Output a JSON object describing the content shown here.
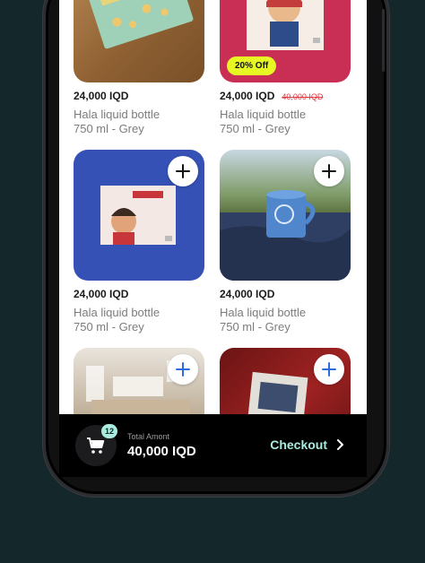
{
  "products": [
    {
      "price": "24,000 IQD",
      "old_price": "",
      "discount": "",
      "name_line1": "Hala liquid bottle",
      "name_line2": "750 ml - Grey",
      "image": "card-on-wood",
      "has_add": false
    },
    {
      "price": "24,000 IQD",
      "old_price": "40,000 IQD",
      "discount": "20% Off",
      "name_line1": "Hala liquid bottle",
      "name_line2": "750 ml - Grey",
      "image": "illustrated-card-red",
      "has_add": false
    },
    {
      "price": "24,000 IQD",
      "old_price": "",
      "discount": "",
      "name_line1": "Hala liquid bottle",
      "name_line2": "750 ml - Grey",
      "image": "illustrated-card-blue",
      "has_add": true
    },
    {
      "price": "24,000 IQD",
      "old_price": "",
      "discount": "",
      "name_line1": "Hala liquid bottle",
      "name_line2": "750 ml - Grey",
      "image": "blue-mug-outdoors",
      "has_add": true
    },
    {
      "price": "",
      "old_price": "",
      "discount": "",
      "name_line1": "",
      "name_line2": "",
      "image": "desk-items",
      "has_add": true
    },
    {
      "price": "",
      "old_price": "",
      "discount": "",
      "name_line1": "",
      "name_line2": "",
      "image": "red-rug-packet",
      "has_add": true
    }
  ],
  "cart": {
    "count": "12",
    "total_label": "Total Amont",
    "total_value": "40,000 IQD",
    "checkout_label": "Checkout"
  },
  "colors": {
    "background": "#14272b",
    "accent": "#a9ecdf",
    "discount_badge": "#e6f724",
    "old_price": "#e3353c"
  },
  "icons": {
    "add": "plus-icon",
    "cart": "cart-icon",
    "checkout": "chevron-right-icon"
  }
}
